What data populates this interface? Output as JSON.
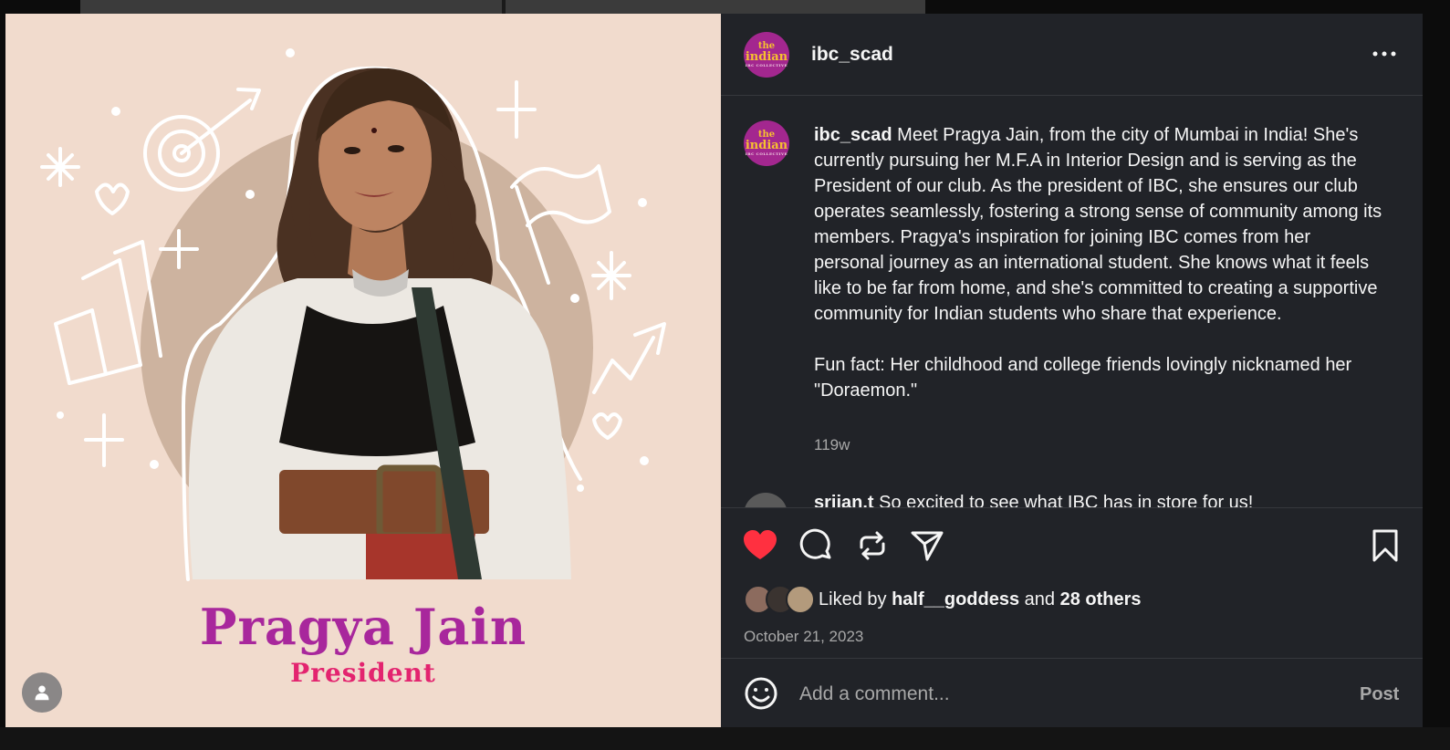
{
  "media": {
    "name_title": "Pragya Jain",
    "role_title": "President",
    "colors": {
      "background": "#f1dbcd",
      "circle": "#cdb39f",
      "name": "#a8279c",
      "role": "#e3246f"
    }
  },
  "account": {
    "username": "ibc_scad",
    "avatar_text": {
      "line1": "the",
      "line2": "indian",
      "line3": "IBC COLLECTIVE"
    }
  },
  "caption": {
    "username": "ibc_scad",
    "text": " Meet Pragya Jain, from the city of Mumbai in India! She's currently pursuing her M.F.A in Interior Design and is serving as the President of our club. As the president of IBC, she ensures our club operates seamlessly, fostering a strong sense of community among its members. Pragya's inspiration for joining IBC comes from her personal journey as an international student. She knows what it feels like to be far from home, and she's committed to creating a supportive community for Indian students who share that experience.\n\nFun fact: Her childhood and college friends lovingly nicknamed her \"Doraemon.\"",
    "time_ago": "119w"
  },
  "comment_preview": {
    "username": "srijan.t",
    "text": "So excited to see what IBC has in store for us!"
  },
  "actions": {
    "like_icon": "heart-filled-icon",
    "comment_icon": "comment-icon",
    "repost_icon": "repost-icon",
    "share_icon": "send-icon",
    "save_icon": "bookmark-icon",
    "liked_color": "#ff3040"
  },
  "likes": {
    "prefix": "Liked by",
    "user": "half__goddess",
    "conjunction": "and",
    "others": "28 others"
  },
  "post_date": "October 21, 2023",
  "comment_box": {
    "placeholder": "Add a comment...",
    "post_label": "Post"
  }
}
